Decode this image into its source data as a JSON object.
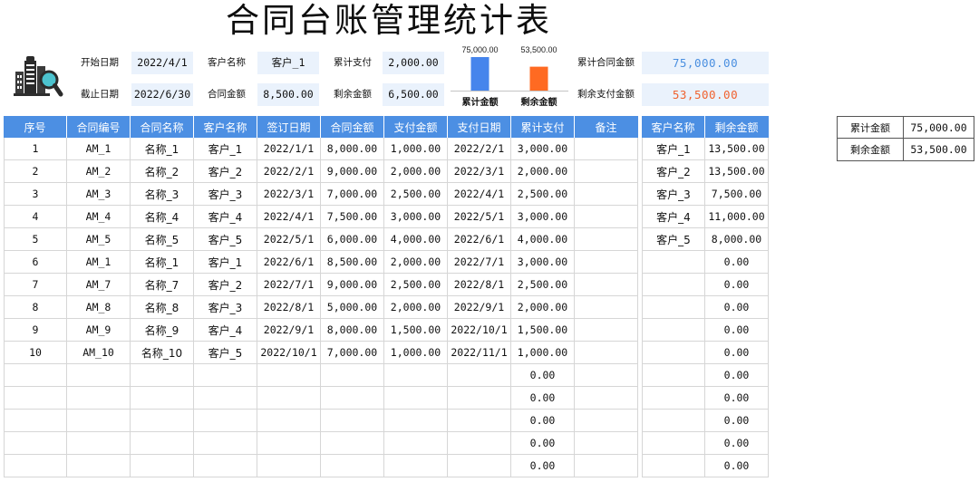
{
  "title": "合同台账管理统计表",
  "filters": {
    "start_date": {
      "label": "开始日期",
      "value": "2022/4/1"
    },
    "end_date": {
      "label": "截止日期",
      "value": "2022/6/30"
    },
    "customer": {
      "label": "客户名称",
      "value": "客户_1"
    },
    "contract_amount": {
      "label": "合同金额",
      "value": "8,500.00"
    },
    "cumulative_paid": {
      "label": "累计支付",
      "value": "2,000.00"
    },
    "remaining": {
      "label": "剩余金额",
      "value": "6,500.00"
    }
  },
  "summary": {
    "total_contract": {
      "label": "累计合同金额",
      "value": "75,000.00",
      "color": "#4a8fe0"
    },
    "remaining_payment": {
      "label": "剩余支付金额",
      "value": "53,500.00",
      "color": "#f0622f"
    }
  },
  "chart_data": {
    "type": "bar",
    "categories": [
      "累计金额",
      "剩余金额"
    ],
    "values": [
      75000,
      53500
    ],
    "value_labels": [
      "75,000.00",
      "53,500.00"
    ],
    "colors": [
      "#4685ec",
      "#ff6a22"
    ],
    "grid": false,
    "legend": "none"
  },
  "ledger": {
    "columns": [
      "序号",
      "合同编号",
      "合同名称",
      "客户名称",
      "签订日期",
      "合同金额",
      "支付金额",
      "支付日期",
      "累计支付",
      "备注"
    ],
    "rows": [
      [
        "1",
        "AM_1",
        "名称_1",
        "客户_1",
        "2022/1/1",
        "8,000.00",
        "1,000.00",
        "2022/2/1",
        "3,000.00",
        ""
      ],
      [
        "2",
        "AM_2",
        "名称_2",
        "客户_2",
        "2022/2/1",
        "9,000.00",
        "2,000.00",
        "2022/3/1",
        "2,000.00",
        ""
      ],
      [
        "3",
        "AM_3",
        "名称_3",
        "客户_3",
        "2022/3/1",
        "7,000.00",
        "2,500.00",
        "2022/4/1",
        "2,500.00",
        ""
      ],
      [
        "4",
        "AM_4",
        "名称_4",
        "客户_4",
        "2022/4/1",
        "7,500.00",
        "3,000.00",
        "2022/5/1",
        "3,000.00",
        ""
      ],
      [
        "5",
        "AM_5",
        "名称_5",
        "客户_5",
        "2022/5/1",
        "6,000.00",
        "4,000.00",
        "2022/6/1",
        "4,000.00",
        ""
      ],
      [
        "6",
        "AM_1",
        "名称_1",
        "客户_1",
        "2022/6/1",
        "8,500.00",
        "2,000.00",
        "2022/7/1",
        "3,000.00",
        ""
      ],
      [
        "7",
        "AM_7",
        "名称_7",
        "客户_2",
        "2022/7/1",
        "9,000.00",
        "2,500.00",
        "2022/8/1",
        "2,500.00",
        ""
      ],
      [
        "8",
        "AM_8",
        "名称_8",
        "客户_3",
        "2022/8/1",
        "5,000.00",
        "2,000.00",
        "2022/9/1",
        "2,000.00",
        ""
      ],
      [
        "9",
        "AM_9",
        "名称_9",
        "客户_4",
        "2022/9/1",
        "8,000.00",
        "1,500.00",
        "2022/10/1",
        "1,500.00",
        ""
      ],
      [
        "10",
        "AM_10",
        "名称_10",
        "客户_5",
        "2022/10/1",
        "7,000.00",
        "1,000.00",
        "2022/11/1",
        "1,000.00",
        ""
      ],
      [
        "",
        "",
        "",
        "",
        "",
        "",
        "",
        "",
        "0.00",
        ""
      ],
      [
        "",
        "",
        "",
        "",
        "",
        "",
        "",
        "",
        "0.00",
        ""
      ],
      [
        "",
        "",
        "",
        "",
        "",
        "",
        "",
        "",
        "0.00",
        ""
      ],
      [
        "",
        "",
        "",
        "",
        "",
        "",
        "",
        "",
        "0.00",
        ""
      ],
      [
        "",
        "",
        "",
        "",
        "",
        "",
        "",
        "",
        "0.00",
        ""
      ]
    ]
  },
  "customer_summary": {
    "columns": [
      "客户名称",
      "剩余金额"
    ],
    "rows": [
      [
        "客户_1",
        "13,500.00"
      ],
      [
        "客户_2",
        "13,500.00"
      ],
      [
        "客户_3",
        "7,500.00"
      ],
      [
        "客户_4",
        "11,000.00"
      ],
      [
        "客户_5",
        "8,000.00"
      ],
      [
        "",
        "0.00"
      ],
      [
        "",
        "0.00"
      ],
      [
        "",
        "0.00"
      ],
      [
        "",
        "0.00"
      ],
      [
        "",
        "0.00"
      ],
      [
        "",
        "0.00"
      ],
      [
        "",
        "0.00"
      ],
      [
        "",
        "0.00"
      ],
      [
        "",
        "0.00"
      ],
      [
        "",
        "0.00"
      ]
    ]
  },
  "totals": {
    "rows": [
      [
        "累计金额",
        "75,000.00"
      ],
      [
        "剩余金额",
        "53,500.00"
      ]
    ]
  },
  "theme": {
    "header_bg": "#4c8fe3",
    "input_bg": "#eaf2fc",
    "grid_line": "#d6d6d6"
  }
}
